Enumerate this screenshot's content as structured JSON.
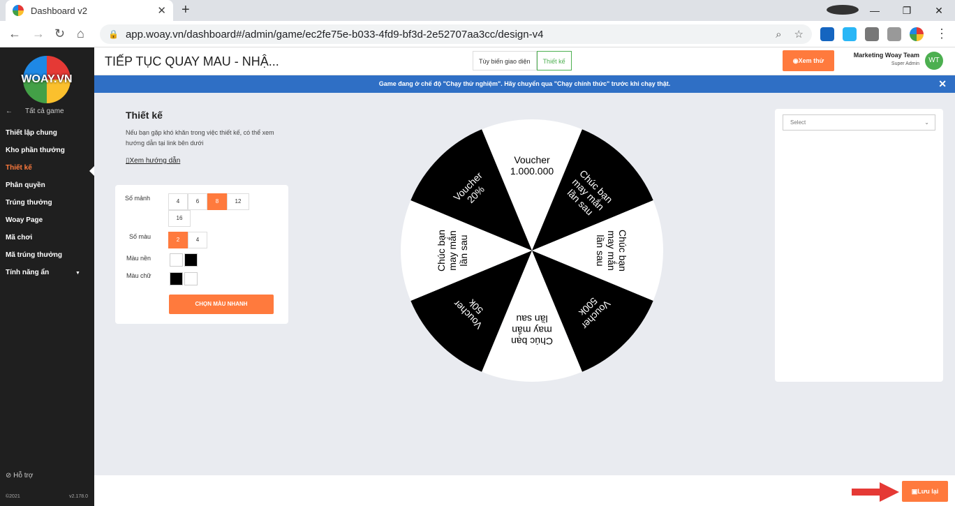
{
  "browser": {
    "tab_title": "Dashboard v2",
    "url": "app.woay.vn/dashboard#/admin/game/ec2fe75e-b033-4fd9-bf3d-2e52707aa3cc/design-v4"
  },
  "sidebar": {
    "logo_text": "WOAY.VN",
    "back_label": "Tất cả game",
    "items": [
      {
        "label": "Thiết lập chung"
      },
      {
        "label": "Kho phần thưởng"
      },
      {
        "label": "Thiết kế"
      },
      {
        "label": "Phân quyền"
      },
      {
        "label": "Trúng thưởng"
      },
      {
        "label": "Woay Page"
      },
      {
        "label": "Mã chơi"
      },
      {
        "label": "Mã trúng thưởng"
      },
      {
        "label": "Tính năng ẩn"
      }
    ],
    "support_label": "Hỗ trợ",
    "copyright": "©2021",
    "version": "v2.178.0"
  },
  "header": {
    "title": "TIẾP TỤC QUAY MAU - NHẬ...",
    "tab_customize": "Tùy biến giao diện",
    "tab_design": "Thiết kế",
    "preview_label": "Xem thử",
    "user_name": "Marketing Woay Team",
    "user_role": "Super Admin",
    "avatar_initials": "WT"
  },
  "banner": {
    "text": "Game đang ở chế độ \"Chạy thử nghiệm\". Hãy chuyển qua \"Chạy chính thức\" trước khi chạy thật."
  },
  "design": {
    "heading": "Thiết kế",
    "description": "Nếu bạn gặp khó khăn trong việc thiết kế, có thể xem hướng dẫn tại link bên dưới",
    "guide_link": "Xem hướng dẫn",
    "pieces_label": "Số mảnh",
    "pieces_options": [
      "4",
      "6",
      "8",
      "12",
      "16"
    ],
    "pieces_selected": "8",
    "colors_label": "Số màu",
    "colors_options": [
      "2",
      "4"
    ],
    "colors_selected": "2",
    "bg_color_label": "Màu nền",
    "text_color_label": "Màu chữ",
    "quick_color_button": "CHỌN MÀU NHANH"
  },
  "wheel": {
    "segments": [
      {
        "label": "Voucher 1.000.000",
        "fill": "#ffffff",
        "text_color": "#000000"
      },
      {
        "label": "Chúc bạn may mắn lần sau",
        "fill": "#000000",
        "text_color": "#ffffff"
      },
      {
        "label": "Chúc bạn may mắn lần sau",
        "fill": "#ffffff",
        "text_color": "#000000"
      },
      {
        "label": "Voucher 500k",
        "fill": "#000000",
        "text_color": "#ffffff"
      },
      {
        "label": "Chúc bạn may mắn lần sau",
        "fill": "#ffffff",
        "text_color": "#000000"
      },
      {
        "label": "Voucher 50k",
        "fill": "#000000",
        "text_color": "#ffffff"
      },
      {
        "label": "Chúc bạn may mắn lần sau",
        "fill": "#ffffff",
        "text_color": "#000000"
      },
      {
        "label": "Voucher 20%",
        "fill": "#000000",
        "text_color": "#ffffff"
      }
    ]
  },
  "right_panel": {
    "select_placeholder": "Select"
  },
  "footer": {
    "save_label": "Lưu lại"
  },
  "colors": {
    "accent": "#ff7a3d",
    "banner": "#2f6fc5",
    "sidebar": "#1f1f1f"
  }
}
